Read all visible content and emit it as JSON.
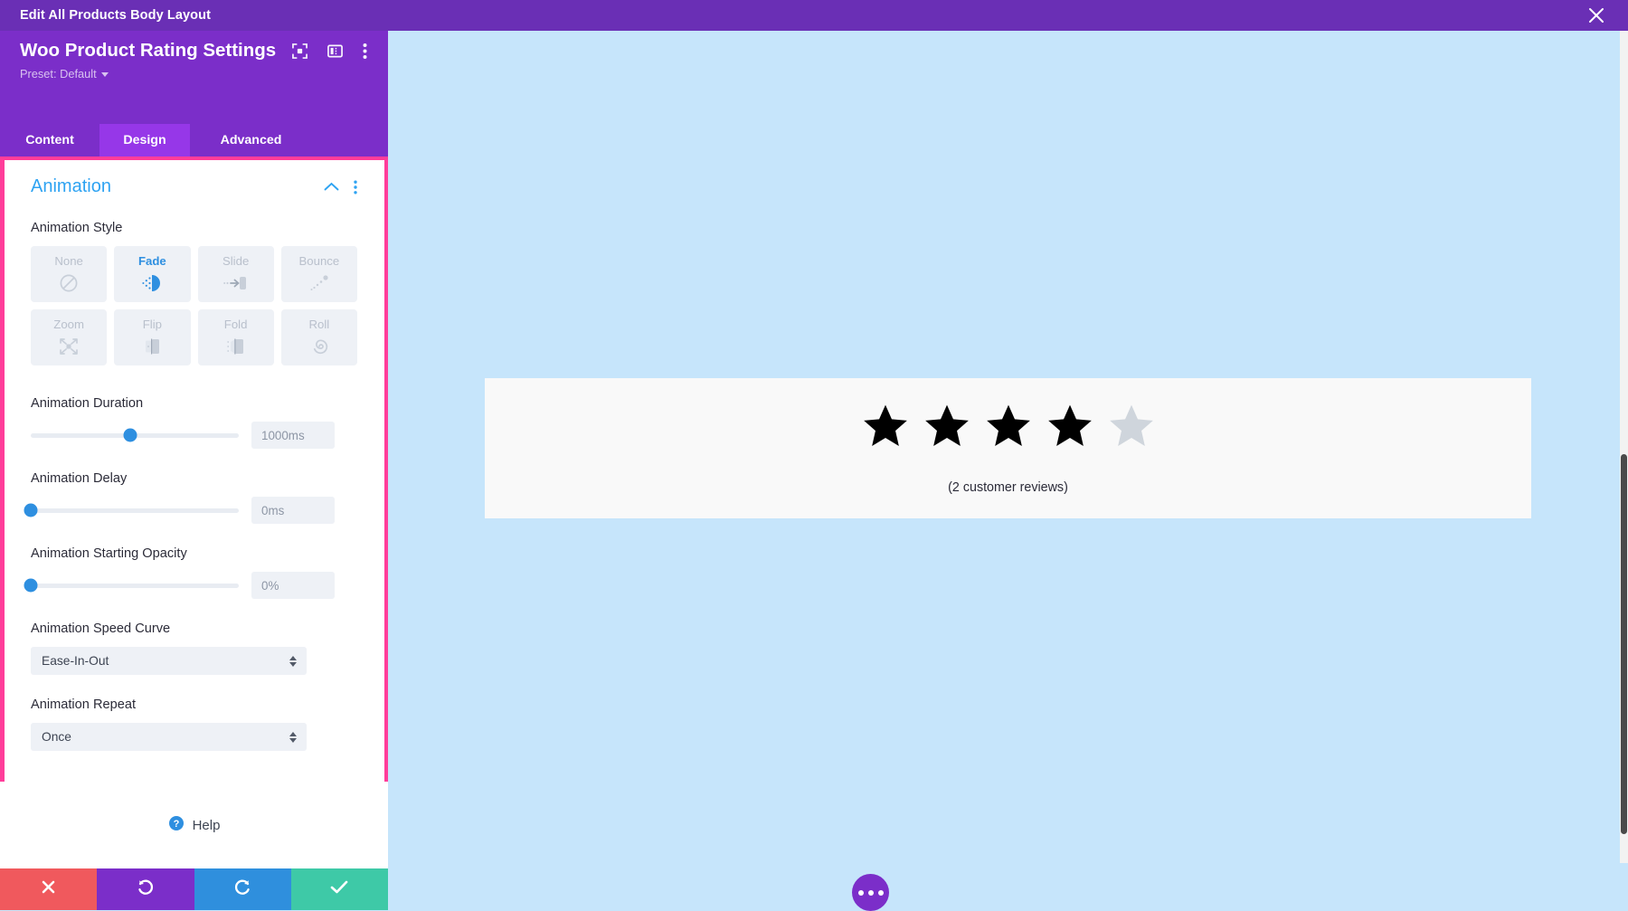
{
  "titlebar": {
    "title": "Edit All Products Body Layout",
    "close_icon": "close-icon"
  },
  "panel": {
    "module_title": "Woo Product Rating Settings",
    "preset_label": "Preset: Default",
    "header_icons": [
      "focus-target-icon",
      "layout-columns-icon",
      "kebab-menu-icon"
    ],
    "tabs": [
      {
        "label": "Content",
        "active": false
      },
      {
        "label": "Design",
        "active": true
      },
      {
        "label": "Advanced",
        "active": false
      }
    ],
    "section": {
      "title": "Animation",
      "collapse_icon": "chevron-up-icon",
      "options_icon": "kebab-menu-icon"
    },
    "animation_style": {
      "label": "Animation Style",
      "selected": "Fade",
      "options": [
        {
          "label": "None",
          "icon": "no-entry-icon",
          "selected": false
        },
        {
          "label": "Fade",
          "icon": "fade-icon",
          "selected": true
        },
        {
          "label": "Slide",
          "icon": "slide-icon",
          "selected": false
        },
        {
          "label": "Bounce",
          "icon": "bounce-icon",
          "selected": false
        },
        {
          "label": "Zoom",
          "icon": "zoom-expand-icon",
          "selected": false
        },
        {
          "label": "Flip",
          "icon": "flip-icon",
          "selected": false
        },
        {
          "label": "Fold",
          "icon": "fold-icon",
          "selected": false
        },
        {
          "label": "Roll",
          "icon": "roll-spiral-icon",
          "selected": false
        }
      ]
    },
    "duration": {
      "label": "Animation Duration",
      "value": "1000ms",
      "slider_percent": 48
    },
    "delay": {
      "label": "Animation Delay",
      "value": "0ms",
      "slider_percent": 0
    },
    "opacity": {
      "label": "Animation Starting Opacity",
      "value": "0%",
      "slider_percent": 0
    },
    "speed_curve": {
      "label": "Animation Speed Curve",
      "value": "Ease-In-Out"
    },
    "repeat": {
      "label": "Animation Repeat",
      "value": "Once"
    },
    "help": {
      "label": "Help",
      "icon": "question-circle-icon"
    },
    "actions": [
      {
        "name": "cancel",
        "icon": "close-x-icon",
        "color": "#f0595d"
      },
      {
        "name": "undo",
        "icon": "undo-icon",
        "color": "#7b2ec9"
      },
      {
        "name": "redo",
        "icon": "redo-icon",
        "color": "#2f8fdd"
      },
      {
        "name": "save",
        "icon": "check-icon",
        "color": "#3ec9a7"
      }
    ]
  },
  "preview": {
    "rating": {
      "filled_stars": 4,
      "total_stars": 5,
      "filled_color": "#000000",
      "empty_color": "#cfd5dc",
      "reviews_text": "(2 customer reviews)"
    },
    "fab": {
      "icon": "ellipsis-icon",
      "color": "#7b2ec9"
    },
    "background_color": "#c6e5fb",
    "card_color": "#f9f9f9"
  },
  "accent": {
    "purple": "#7b2ec9",
    "purple_dark": "#6a2fb5",
    "pink_outline": "#ff3d9a",
    "blue": "#2ea3f2"
  }
}
